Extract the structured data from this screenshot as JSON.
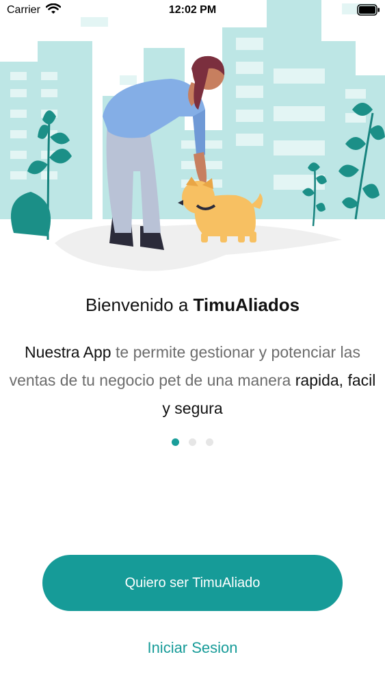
{
  "status_bar": {
    "carrier": "Carrier",
    "time": "12:02 PM",
    "icons": [
      "wifi-icon",
      "battery-icon"
    ]
  },
  "welcome": {
    "prefix": "Bienvenido a ",
    "brand": "TimuAliados"
  },
  "description": {
    "bold_1": "Nuestra App",
    "text_1": " te permite gestionar y potenciar las ventas de tu negocio pet de una manera ",
    "bold_2": "rapida, facil y segura"
  },
  "pager": {
    "pages": 3,
    "active_index": 0
  },
  "buttons": {
    "primary": "Quiero ser TimuAliado",
    "secondary": "Iniciar Sesion"
  },
  "colors": {
    "accent": "#169b98",
    "city": "#bde6e5",
    "leaf": "#17837e",
    "text": "#111111",
    "muted_text": "#6c6c6c"
  }
}
